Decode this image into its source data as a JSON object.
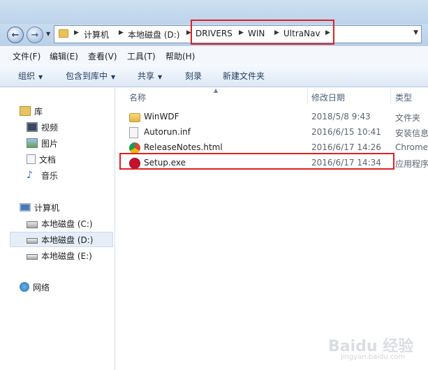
{
  "address": {
    "crumbs": [
      "计算机",
      "本地磁盘 (D:)",
      "DRIVERS",
      "WIN",
      "UltraNav"
    ]
  },
  "menu": {
    "items": [
      "文件(F)",
      "编辑(E)",
      "查看(V)",
      "工具(T)",
      "帮助(H)"
    ]
  },
  "toolbar": {
    "organize": "组织",
    "include_in_library": "包含到库中",
    "share": "共享",
    "burn": "刻录",
    "new_folder": "新建文件夹"
  },
  "nav": {
    "libraries": "库",
    "videos": "视频",
    "pictures": "图片",
    "documents": "文档",
    "music": "音乐",
    "computer": "计算机",
    "drive_c": "本地磁盘 (C:)",
    "drive_d": "本地磁盘 (D:)",
    "drive_e": "本地磁盘 (E:)",
    "network": "网络"
  },
  "columns": {
    "name": "名称",
    "date": "修改日期",
    "type": "类型"
  },
  "files": [
    {
      "name": "WinWDF",
      "date": "2018/5/8 9:43",
      "type": "文件夹",
      "icon": "folder-icon"
    },
    {
      "name": "Autorun.inf",
      "date": "2016/6/15 10:41",
      "type": "安装信息",
      "icon": "settings-file-icon"
    },
    {
      "name": "ReleaseNotes.html",
      "date": "2016/6/17 14:26",
      "type": "Chrome",
      "icon": "chrome-icon"
    },
    {
      "name": "Setup.exe",
      "date": "2016/6/17 14:34",
      "type": "应用程序",
      "icon": "setup-exe-icon"
    }
  ],
  "watermark": {
    "text": "Baidu 经验",
    "sub": "jingyan.baidu.com"
  },
  "colors": {
    "highlight": "#e02020",
    "selection": "#e5eef8"
  }
}
